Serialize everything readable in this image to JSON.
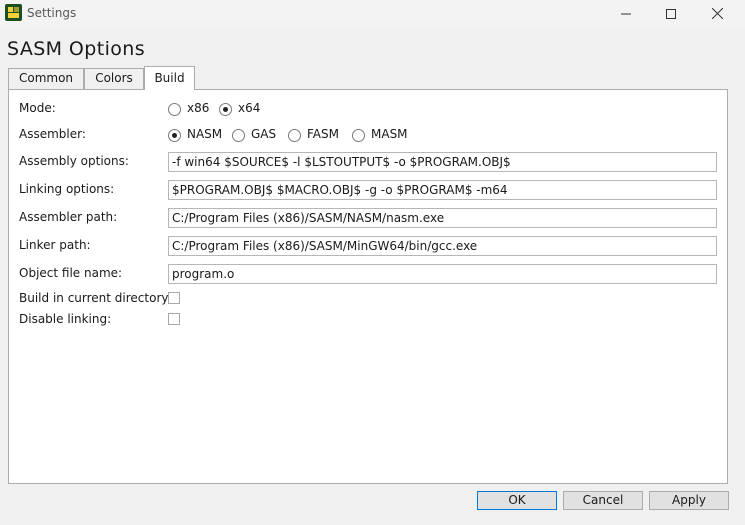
{
  "window": {
    "title": "Settings"
  },
  "heading": "SASM Options",
  "tabs": [
    {
      "label": "Common"
    },
    {
      "label": "Colors"
    },
    {
      "label": "Build"
    }
  ],
  "build": {
    "mode": {
      "label": "Mode:",
      "options": [
        "x86",
        "x64"
      ],
      "selected": "x64"
    },
    "assembler": {
      "label": "Assembler:",
      "options": [
        "NASM",
        "GAS",
        "FASM",
        "MASM"
      ],
      "selected": "NASM"
    },
    "assembly_options": {
      "label": "Assembly options:",
      "value": "-f win64 $SOURCE$ -l $LSTOUTPUT$ -o $PROGRAM.OBJ$"
    },
    "linking_options": {
      "label": "Linking options:",
      "value": "$PROGRAM.OBJ$ $MACRO.OBJ$ -g -o $PROGRAM$ -m64"
    },
    "assembler_path": {
      "label": "Assembler path:",
      "value": "C:/Program Files (x86)/SASM/NASM/nasm.exe"
    },
    "linker_path": {
      "label": "Linker path:",
      "value": "C:/Program Files (x86)/SASM/MinGW64/bin/gcc.exe"
    },
    "object_file_name": {
      "label": "Object file name:",
      "value": "program.o"
    },
    "build_in_current_dir": {
      "label": "Build in current directory:",
      "checked": false
    },
    "disable_linking": {
      "label": "Disable linking:",
      "checked": false
    }
  },
  "buttons": {
    "ok": "OK",
    "cancel": "Cancel",
    "apply": "Apply"
  },
  "colors": {
    "accent": "#0078d7",
    "app_icon_bg": "#1f4e1f",
    "app_icon_fg": "#f2d43a"
  },
  "icons": [
    "app-logo-icon",
    "minimize-icon",
    "maximize-icon",
    "close-icon"
  ]
}
